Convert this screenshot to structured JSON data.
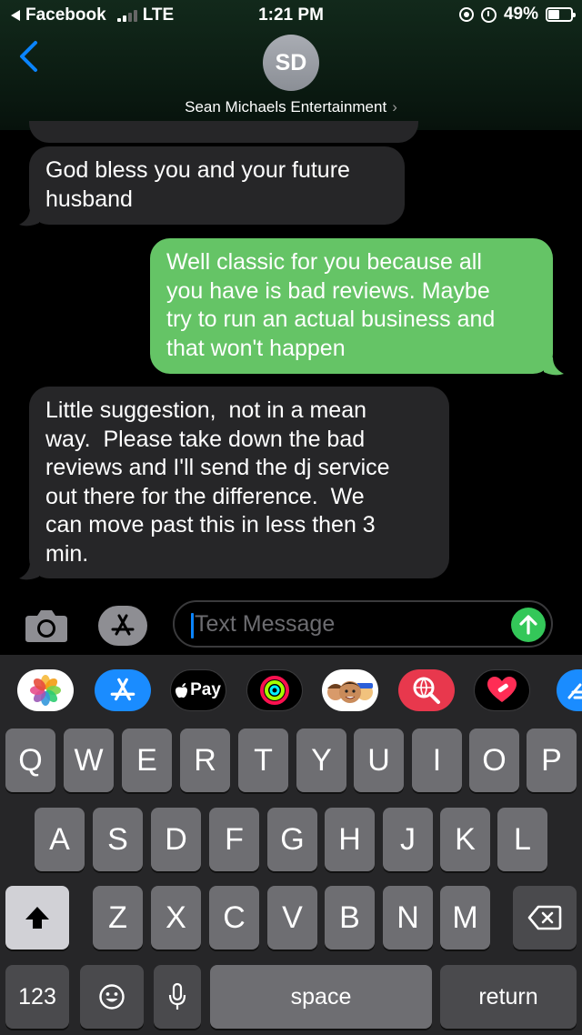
{
  "status_bar": {
    "back_app": "Facebook",
    "network": "LTE",
    "time": "1:21 PM",
    "battery_percent": "49%",
    "battery_level": 0.49,
    "signal_bars": 4,
    "signal_bars_filled": 2
  },
  "header": {
    "avatar_initials": "SD",
    "contact_name": "Sean Michaels Entertainment",
    "chevron": "›"
  },
  "messages": [
    {
      "direction": "received",
      "text": "God bless you and your future\nhusband"
    },
    {
      "direction": "sent",
      "text": "Well classic for you because all\nyou have is bad reviews. Maybe\ntry to run an actual business and\nthat won't happen"
    },
    {
      "direction": "received",
      "text": "Little suggestion,  not in a mean\nway.  Please take down the bad\nreviews and I'll send the dj service\nout there for the difference.  We\ncan move past this in less then 3\nmin."
    }
  ],
  "compose": {
    "placeholder": "Text Message",
    "camera_icon": "camera-icon",
    "appstore_icon": "app-store-icon",
    "send_icon": "arrow-up-icon"
  },
  "app_drawer": [
    {
      "name": "photos",
      "icon": "photos-icon"
    },
    {
      "name": "app-store",
      "icon": "app-store-icon"
    },
    {
      "name": "apple-pay",
      "label": "Pay",
      "icon": "apple-pay-icon"
    },
    {
      "name": "activity",
      "icon": "activity-rings-icon"
    },
    {
      "name": "memoji",
      "icon": "memoji-icon"
    },
    {
      "name": "images-search",
      "icon": "globe-search-icon"
    },
    {
      "name": "digital-touch",
      "icon": "heart-icon"
    },
    {
      "name": "more",
      "icon": "more-app-icon"
    }
  ],
  "keyboard": {
    "row1": [
      "Q",
      "W",
      "E",
      "R",
      "T",
      "Y",
      "U",
      "I",
      "O",
      "P"
    ],
    "row2": [
      "A",
      "S",
      "D",
      "F",
      "G",
      "H",
      "J",
      "K",
      "L"
    ],
    "row3": [
      "Z",
      "X",
      "C",
      "V",
      "B",
      "N",
      "M"
    ],
    "numbers_label": "123",
    "space_label": "space",
    "return_label": "return",
    "shift_icon": "shift-arrow-icon",
    "delete_icon": "backspace-icon",
    "emoji_icon": "emoji-icon",
    "mic_icon": "microphone-icon"
  },
  "colors": {
    "sent_bubble": "#65c466",
    "received_bubble": "#262628",
    "accent": "#0a84ff",
    "send_button": "#34c759"
  }
}
